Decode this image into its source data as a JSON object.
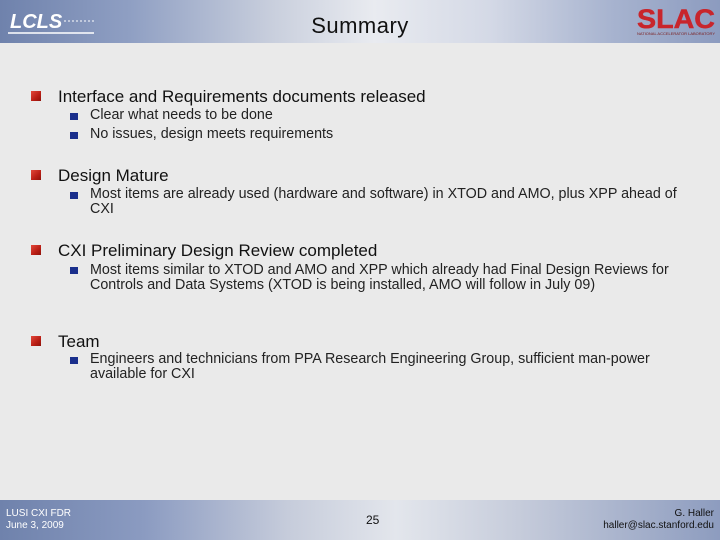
{
  "header": {
    "title": "Summary",
    "left_logo_text": "LCLS",
    "right_logo_text": "SLAC",
    "right_logo_subtext": "NATIONAL ACCELERATOR LABORATORY"
  },
  "items": [
    {
      "heading": "Interface and Requirements documents released",
      "subs": [
        "Clear what needs to be done",
        "No issues, design meets requirements"
      ]
    },
    {
      "heading": "Design Mature",
      "subs": [
        "Most items are already used (hardware and software) in XTOD and AMO, plus XPP ahead of CXI"
      ]
    },
    {
      "heading": "CXI Preliminary Design Review completed",
      "subs": [
        "Most items similar to XTOD and AMO and XPP which already had Final Design Reviews for Controls and Data Systems (XTOD is being installed, AMO will follow in July 09)"
      ]
    },
    {
      "heading": "Team",
      "subs": [
        "Engineers and technicians from PPA Research Engineering Group, sufficient man-power available for CXI"
      ]
    }
  ],
  "footer": {
    "left_line1": "LUSI CXI FDR",
    "left_line2": "June 3, 2009",
    "page_number": "25",
    "right_line1": "G. Haller",
    "right_line2": "haller@slac.stanford.edu"
  },
  "colors": {
    "bullet_red": "#c0221a",
    "sub_bullet_blue": "#1a2f8c",
    "slac_red": "#c8252c"
  },
  "icons": {
    "bullet": "red-square-icon",
    "sub_bullet": "blue-square-icon"
  }
}
